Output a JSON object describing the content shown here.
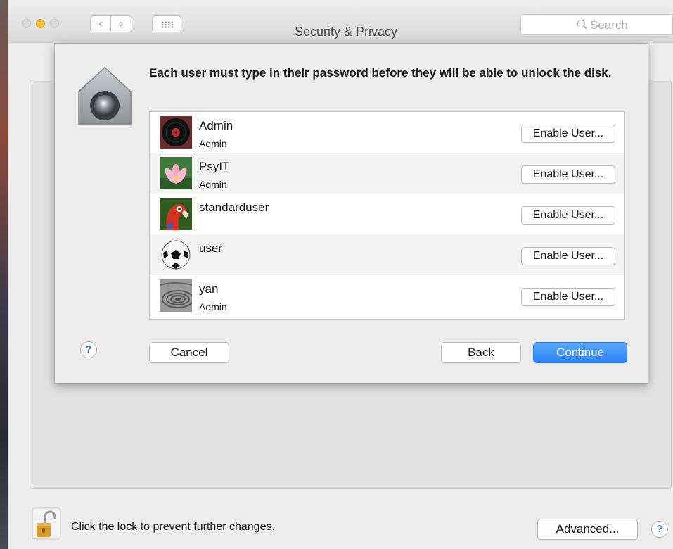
{
  "window": {
    "title": "Security & Privacy",
    "search_placeholder": "Search"
  },
  "toolbar": {
    "back_icon": "‹",
    "forward_icon": "›"
  },
  "sheet": {
    "message": "Each user must type in their password before they will be able to unlock the disk.",
    "users": [
      {
        "name": "Admin",
        "role": "Admin",
        "button": "Enable User...",
        "avatar": "vinyl-record"
      },
      {
        "name": "PsyIT",
        "role": "Admin",
        "button": "Enable User...",
        "avatar": "lotus-flower"
      },
      {
        "name": "standarduser",
        "role": "",
        "button": "Enable User...",
        "avatar": "parrot"
      },
      {
        "name": "user",
        "role": "",
        "button": "Enable User...",
        "avatar": "soccer-ball"
      },
      {
        "name": "yan",
        "role": "Admin",
        "button": "Enable User...",
        "avatar": "zen-sand"
      }
    ],
    "help_label": "?",
    "cancel_label": "Cancel",
    "back_label": "Back",
    "continue_label": "Continue"
  },
  "footer": {
    "lock_text": "Click the lock to prevent further changes.",
    "advanced_label": "Advanced...",
    "help_label": "?"
  },
  "colors": {
    "accent": "#2b84f5",
    "minimize": "#f5bd2f"
  }
}
